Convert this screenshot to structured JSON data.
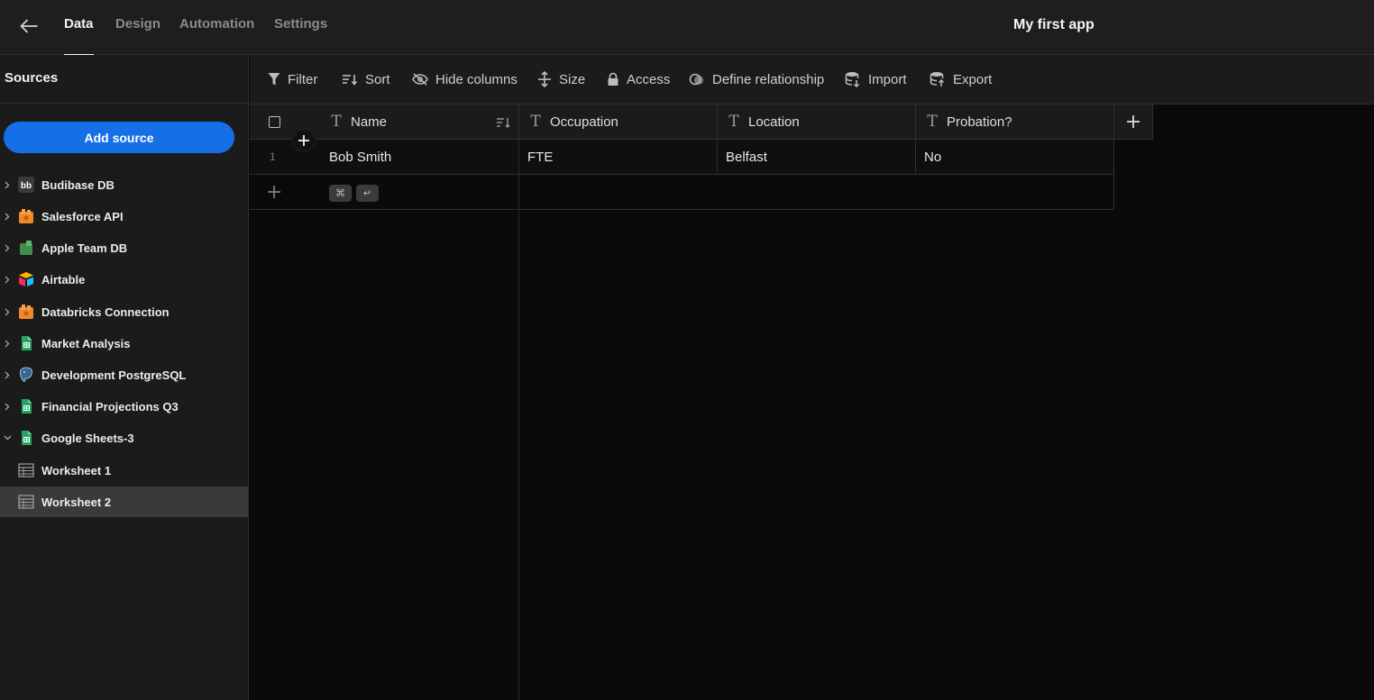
{
  "topbar": {
    "tabs": [
      {
        "label": "Data",
        "active": true
      },
      {
        "label": "Design",
        "active": false
      },
      {
        "label": "Automation",
        "active": false
      },
      {
        "label": "Settings",
        "active": false
      }
    ],
    "app_title": "My first app"
  },
  "sidebar": {
    "title": "Sources",
    "add_source_label": "Add source",
    "items": [
      {
        "label": "Budibase DB",
        "icon": "budibase-icon",
        "expanded": false
      },
      {
        "label": "Salesforce API",
        "icon": "rest-api-icon",
        "expanded": false
      },
      {
        "label": "Apple Team DB",
        "icon": "database-green-icon",
        "expanded": false
      },
      {
        "label": "Airtable",
        "icon": "airtable-icon",
        "expanded": false
      },
      {
        "label": "Databricks Connection",
        "icon": "rest-api-icon",
        "expanded": false
      },
      {
        "label": "Market Analysis",
        "icon": "google-sheets-icon",
        "expanded": false
      },
      {
        "label": "Development PostgreSQL",
        "icon": "postgresql-icon",
        "expanded": false
      },
      {
        "label": "Financial Projections Q3",
        "icon": "google-sheets-icon",
        "expanded": false
      },
      {
        "label": "Google Sheets-3",
        "icon": "google-sheets-icon",
        "expanded": true
      },
      {
        "label": "Worksheet 1",
        "icon": "table-icon",
        "child": true
      },
      {
        "label": "Worksheet 2",
        "icon": "table-icon",
        "child": true,
        "selected": true
      }
    ]
  },
  "toolbar": {
    "filter": "Filter",
    "sort": "Sort",
    "hide_columns": "Hide columns",
    "size": "Size",
    "access": "Access",
    "define_relationship": "Define relationship",
    "import": "Import",
    "export": "Export"
  },
  "grid": {
    "columns": [
      "Name",
      "Occupation",
      "Location",
      "Probation?"
    ],
    "rows": [
      {
        "index": "1",
        "cells": [
          "Bob Smith",
          "FTE",
          "Belfast",
          "No"
        ]
      }
    ],
    "shortcut_keys": [
      "⌘",
      "↵"
    ]
  },
  "colors": {
    "accent": "#1570e8",
    "background": "#0a0a0a",
    "panel": "#1b1b1b"
  }
}
